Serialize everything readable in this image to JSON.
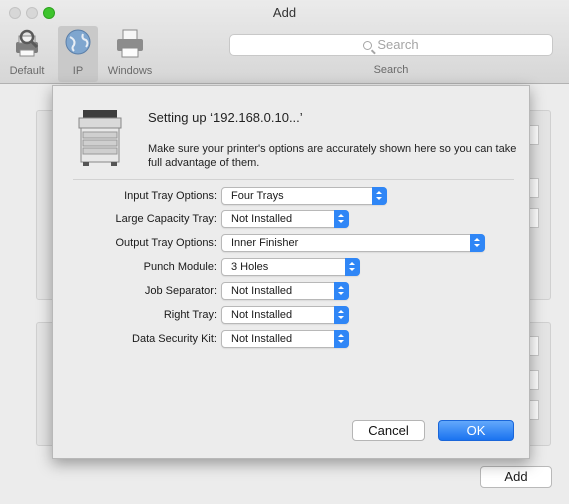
{
  "window": {
    "title": "Add"
  },
  "toolbar": {
    "items": [
      {
        "label": "Default",
        "icon": "default-printer-icon"
      },
      {
        "label": "IP",
        "icon": "ip-globe-icon"
      },
      {
        "label": "Windows",
        "icon": "windows-printer-icon"
      }
    ],
    "search_placeholder": "Search",
    "search_caption": "Search"
  },
  "sheet": {
    "title": "Setting up ‘192.168.0.10...’",
    "message": "Make sure your printer's options are accurately shown here so you can take full advantage of them.",
    "options": [
      {
        "label": "Input Tray Options:",
        "value": "Four Trays"
      },
      {
        "label": "Large Capacity Tray:",
        "value": "Not Installed"
      },
      {
        "label": "Output Tray Options:",
        "value": "Inner Finisher"
      },
      {
        "label": "Punch Module:",
        "value": "3 Holes"
      },
      {
        "label": "Job Separator:",
        "value": "Not Installed"
      },
      {
        "label": "Right Tray:",
        "value": "Not Installed"
      },
      {
        "label": "Data Security Kit:",
        "value": "Not Installed"
      }
    ],
    "cancel_label": "Cancel",
    "ok_label": "OK"
  },
  "footer": {
    "add_label": "Add"
  },
  "colors": {
    "accent": "#2f86f6",
    "zoom_button": "#3ec42d"
  }
}
